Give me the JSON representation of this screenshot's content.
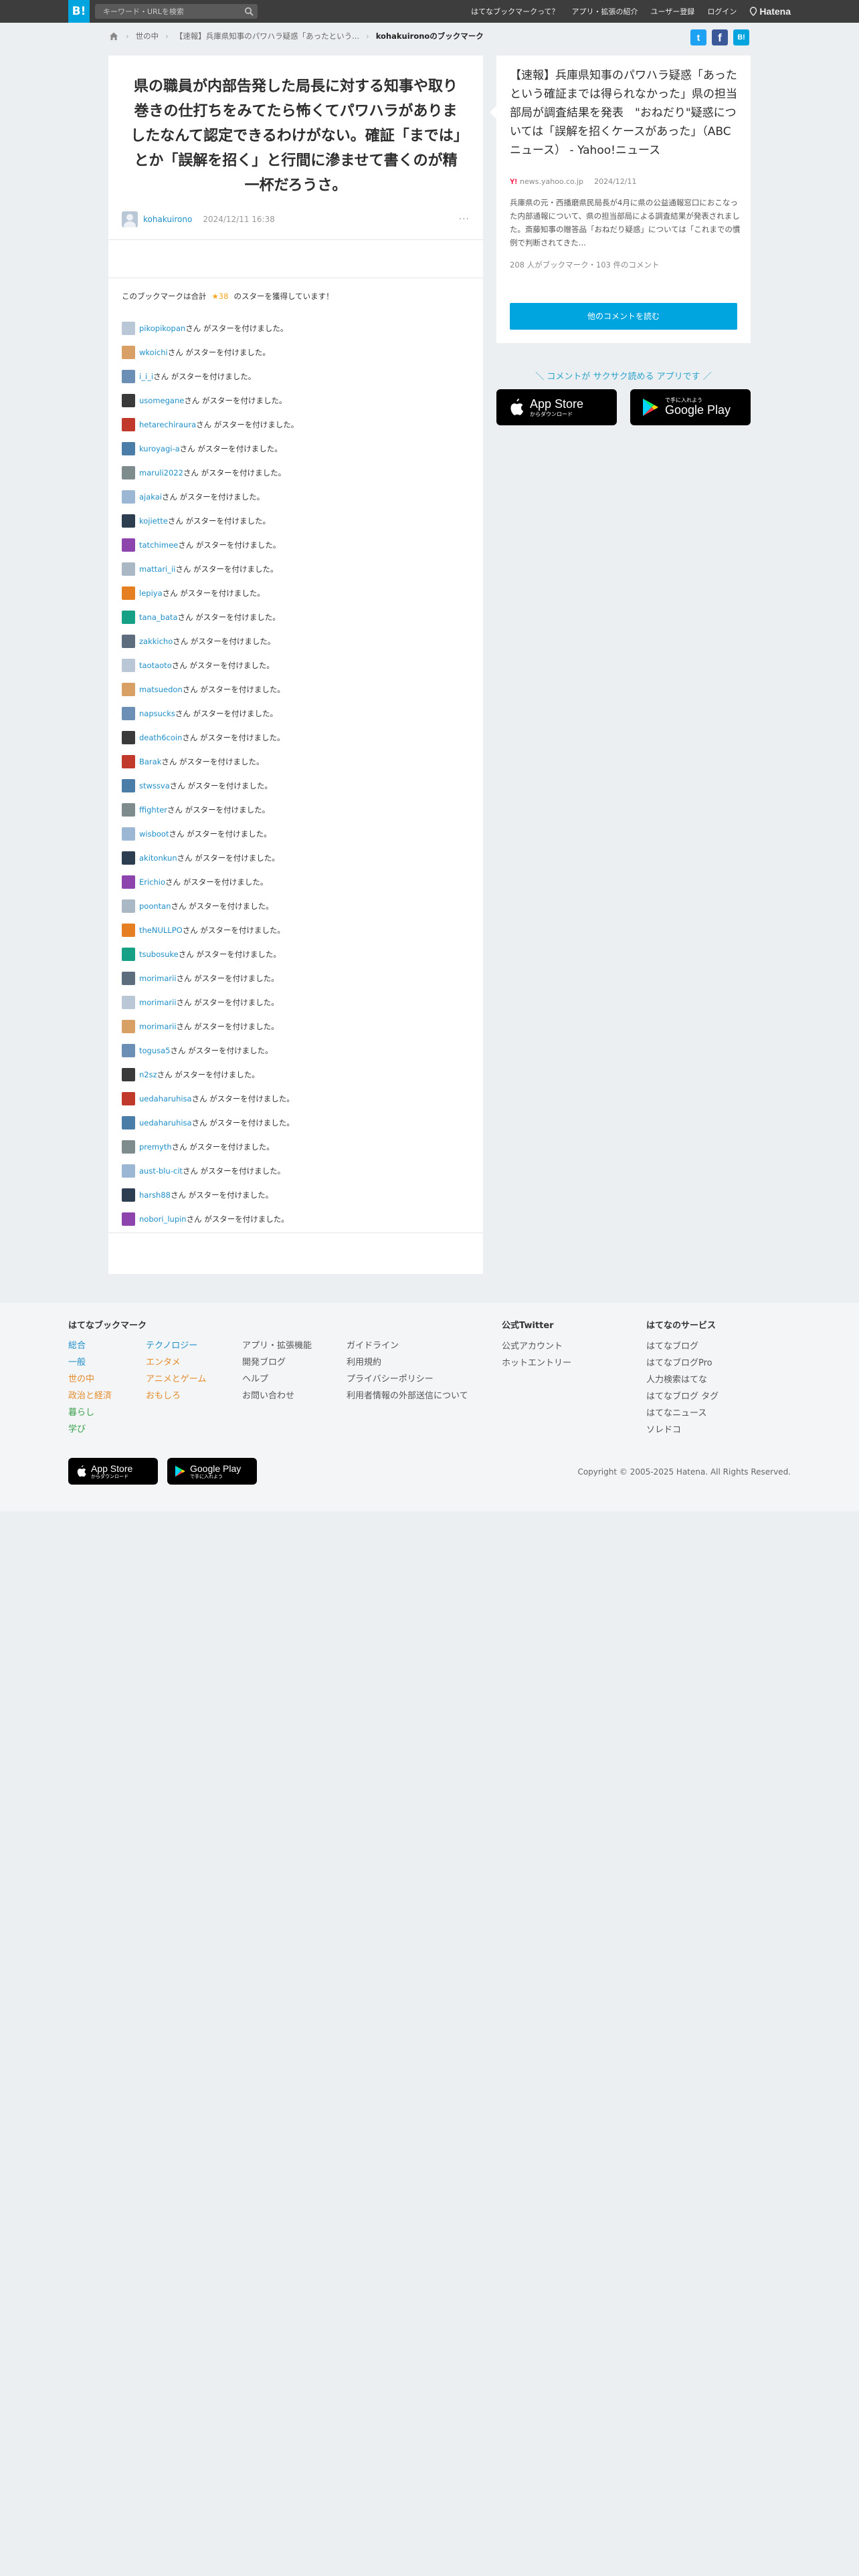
{
  "topbar": {
    "logo": "B!",
    "search_placeholder": "キーワード・URLを検索",
    "nav": [
      "はてなブックマークって？",
      "アプリ・拡張の紹介",
      "ユーザー登録",
      "ログイン"
    ],
    "brand": "Hatena"
  },
  "breadcrumb": {
    "items": [
      "世の中",
      "【速報】兵庫県知事のパワハラ疑惑「あったという..."
    ],
    "current": "kohakuironoのブックマーク"
  },
  "social": {
    "twitter": "t",
    "facebook": "f",
    "hatena": "B!"
  },
  "comment": {
    "text": "県の職員が内部告発した局長に対する知事や取り巻きの仕打ちをみてたら怖くてパワハラがありましたなんて認定できるわけがない。確証「までは」とか「誤解を招く」と行間に滲ませて書くのが精一杯だろうさ。",
    "user": "kohakuirono",
    "date": "2024/12/11 16:38",
    "more": "···"
  },
  "stars": {
    "head_prefix": "このブックマークは合計",
    "count": "★38",
    "head_suffix": "のスターを獲得しています！",
    "suffix": "さん がスターを付けました。",
    "users": [
      "pikopikopan",
      "wkoichi",
      "i_i_i",
      "usomegane",
      "hetarechiraura",
      "kuroyagi-a",
      "maruli2022",
      "ajakai",
      "kojiette",
      "tatchimee",
      "mattari_ii",
      "lepiya",
      "tana_bata",
      "zakkicho",
      "taotaoto",
      "matsuedon",
      "napsucks",
      "death6coin",
      "Barak",
      "stwssva",
      "ffighter",
      "wisboot",
      "akitonkun",
      "Erichio",
      "poontan",
      "theNULLPO",
      "tsubosuke",
      "morimarii",
      "morimarii",
      "morimarii",
      "togusa5",
      "n2sz",
      "uedaharuhisa",
      "uedaharuhisa",
      "premyth",
      "aust-blu-cit",
      "harsh88",
      "nobori_lupin"
    ]
  },
  "entry": {
    "title": "【速報】兵庫県知事のパワハラ疑惑「あったという確証までは得られなかった」県の担当部局が調査結果を発表　\"おねだり\"疑惑については「誤解を招くケースがあった」（ABCニュース） - Yahoo!ニュース",
    "domain": "news.yahoo.co.jp",
    "date": "2024/12/11",
    "summary": "兵庫県の元・西播磨県民局長が4月に県の公益通報窓口におこなった内部通報について、県の担当部局による調査結果が発表されました。斎藤知事の贈答品「おねだり疑惑」については「これまでの慣例で判断されてきた...",
    "counts": "208 人がブックマーク・103 件のコメント",
    "other_button": "他のコメントを読む"
  },
  "app_promo": {
    "text": "＼ コメントが サクサク読める アプリです ／",
    "appstore_small": "からダウンロード",
    "appstore_big": "App Store",
    "googleplay_small": "で手に入れよう",
    "googleplay_big": "Google Play"
  },
  "footer": {
    "bookmark_heading": "はてなブックマーク",
    "categories_col1": [
      "総合",
      "一般",
      "世の中",
      "政治と経済",
      "暮らし",
      "学び"
    ],
    "categories_col2": [
      "テクノロジー",
      "エンタメ",
      "アニメとゲーム",
      "おもしろ"
    ],
    "links_col3": [
      "アプリ・拡張機能",
      "開発ブログ",
      "ヘルプ",
      "お問い合わせ"
    ],
    "links_col4": [
      "ガイドライン",
      "利用規約",
      "プライバシーポリシー",
      "利用者情報の外部送信について"
    ],
    "twitter_heading": "公式Twitter",
    "twitter_links": [
      "公式アカウント",
      "ホットエントリー"
    ],
    "services_heading": "はてなのサービス",
    "services": [
      "はてなブログ",
      "はてなブログPro",
      "人力検索はてな",
      "はてなブログ タグ",
      "はてなニュース",
      "ソレドコ"
    ],
    "appstore_big": "App Store",
    "appstore_small": "からダウンロード",
    "googleplay_big": "Google Play",
    "googleplay_small": "で手に入れよう",
    "copyright": "Copyright © 2005-2025 Hatena. All Rights Reserved."
  },
  "colors": {
    "accent": "#00a4de",
    "link": "#1f8fc8",
    "star": "#f5a623"
  }
}
